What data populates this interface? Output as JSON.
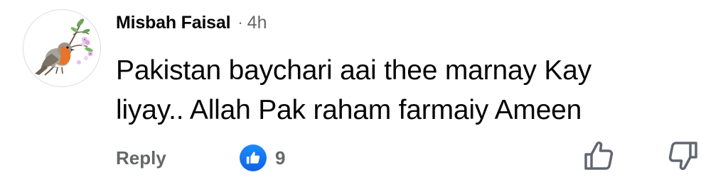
{
  "comment": {
    "author": "Misbah Faisal",
    "separator": "·",
    "time": "4h",
    "text": "Pakistan baychari aai thee marnay Kay liyay.. Allah Pak raham farmaiy Ameen",
    "reply_label": "Reply",
    "reaction": {
      "icon": "thumbs-up-icon",
      "count": "9"
    },
    "actions": {
      "like_icon": "thumbs-up-outline-icon",
      "dislike_icon": "thumbs-down-outline-icon"
    },
    "avatar_icon": "robin-bird-icon"
  },
  "colors": {
    "text_primary": "#050505",
    "text_secondary": "#65676b",
    "reaction_blue": "#1877f2"
  }
}
